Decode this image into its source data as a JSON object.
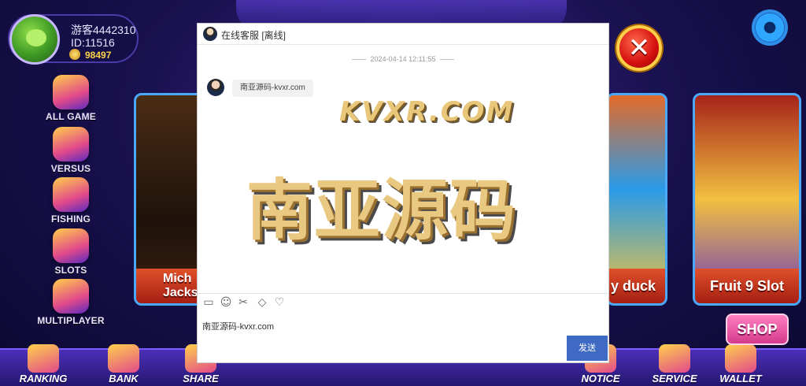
{
  "profile": {
    "name": "游客4442310",
    "id": "ID:11516",
    "coins": "98497"
  },
  "side_nav": [
    {
      "label": "ALL GAME"
    },
    {
      "label": "VERSUS"
    },
    {
      "label": "FISHING"
    },
    {
      "label": "SLOTS"
    },
    {
      "label": "MULTIPLAYER"
    }
  ],
  "cards": {
    "michael": {
      "label": "Mich Jackson"
    },
    "duck": {
      "label": "y duck"
    },
    "fruit": {
      "label": "Fruit 9 Slot"
    }
  },
  "shop_label": "SHOP",
  "bottom_nav": [
    {
      "label": "RANKING"
    },
    {
      "label": "BANK"
    },
    {
      "label": "SHARE"
    },
    {
      "label": "NOTICE"
    },
    {
      "label": "SERVICE"
    },
    {
      "label": "WALLET"
    }
  ],
  "chat": {
    "title": "在线客服 [离线]",
    "timestamp": "2024-04-14 12:11:55",
    "message": "南亚源码-kvxr.com",
    "input_value": "南亚源码-kvxr.com",
    "send_label": "发送",
    "toolbar_icons": [
      "folder-icon",
      "emoji-icon",
      "scissors-icon",
      "rating-icon",
      "bell-icon"
    ]
  },
  "watermark": {
    "url_text": "KVXR.COM",
    "main_text": "南亚源码"
  },
  "colors": {
    "send_button": "#3f6ac4",
    "close_button": "#d40f0f",
    "accent": "#4aa8ff"
  }
}
